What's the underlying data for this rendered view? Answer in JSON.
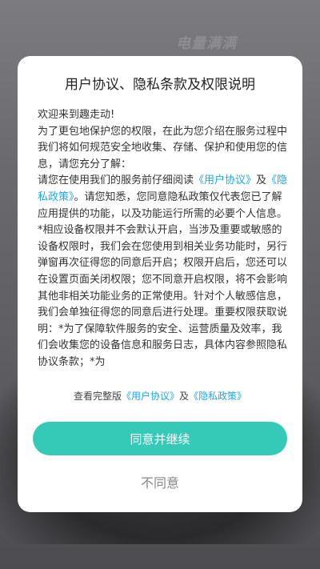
{
  "background": {
    "banner_text": "电量满满"
  },
  "dialog": {
    "title": "用户协议、隐私条款及权限说明",
    "welcome": "欢迎来到趣走动!",
    "para1": "为了更包地保护您的权限，在此为您介绍在服务过程中我们将如何规范安全地收集、存储、保护和使用您的信息，请您充分了解：",
    "para2_prefix": "请您在使用我们的服务前仔细阅读",
    "user_agreement_link": "《用户协议》",
    "and": "及",
    "privacy_link": "《隐私政策》",
    "para2_suffix": "。请您知悉，您同意隐私政策仅代表您已了解应用提供的功能，以及功能运行所需的必要个人信息。",
    "para3": "*相应设备权限并不会默认开启，当涉及重要或敏感的设备权限时，我们会在您使用到相关业务功能时，另行弹窗再次征得您的同意后开启；权限开启后，您还可以在设置页面关闭权限；您不同意开启权限，将不会影响其他非相关功能业务的正常使用。针对个人敏感信息，我们会单独征得您的同意后进行处理。重要权限获取说明：*为了保障软件服务的安全、运营质量及效率，我们会收集您的设备信息和服务日志，具体内容参照隐私协议条款；*为",
    "footer_prefix": "查看完整版",
    "footer_user_agreement": "《用户协议》",
    "footer_and": "及",
    "footer_privacy": "《隐私政策》",
    "agree_button": "同意并继续",
    "disagree_button": "不同意"
  },
  "colors": {
    "accent": "#35c9b8",
    "link": "#1aa8ee"
  }
}
